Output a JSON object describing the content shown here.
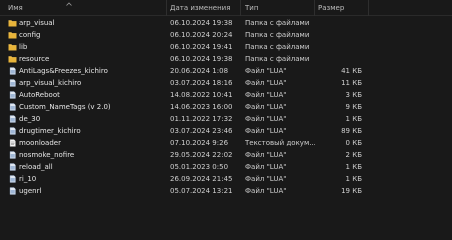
{
  "columns": {
    "name": "Имя",
    "date": "Дата изменения",
    "type": "Тип",
    "size": "Размер"
  },
  "rows": [
    {
      "kind": "folder",
      "name": "arp_visual",
      "date": "06.10.2024 19:38",
      "type": "Папка с файлами",
      "size": ""
    },
    {
      "kind": "folder",
      "name": "config",
      "date": "06.10.2024 20:24",
      "type": "Папка с файлами",
      "size": ""
    },
    {
      "kind": "folder",
      "name": "lib",
      "date": "06.10.2024 19:41",
      "type": "Папка с файлами",
      "size": ""
    },
    {
      "kind": "folder",
      "name": "resource",
      "date": "06.10.2024 19:38",
      "type": "Папка с файлами",
      "size": ""
    },
    {
      "kind": "file",
      "name": "AntiLags&Freezes_kichiro",
      "date": "20.06.2024 1:08",
      "type": "Файл \"LUA\"",
      "size": "41 КБ"
    },
    {
      "kind": "file",
      "name": "arp_visual_kichiro",
      "date": "03.07.2024 18:16",
      "type": "Файл \"LUA\"",
      "size": "11 КБ"
    },
    {
      "kind": "file",
      "name": "AutoReboot",
      "date": "14.08.2022 10:41",
      "type": "Файл \"LUA\"",
      "size": "3 КБ"
    },
    {
      "kind": "file",
      "name": "Custom_NameTags (v 2.0)",
      "date": "14.06.2023 16:00",
      "type": "Файл \"LUA\"",
      "size": "9 КБ"
    },
    {
      "kind": "file",
      "name": "de_30",
      "date": "01.11.2022 17:32",
      "type": "Файл \"LUA\"",
      "size": "1 КБ"
    },
    {
      "kind": "file",
      "name": "drugtimer_kichiro",
      "date": "03.07.2024 23:46",
      "type": "Файл \"LUA\"",
      "size": "89 КБ"
    },
    {
      "kind": "text",
      "name": "moonloader",
      "date": "07.10.2024 9:26",
      "type": "Текстовый докум...",
      "size": "0 КБ"
    },
    {
      "kind": "file",
      "name": "nosmoke_nofire",
      "date": "29.05.2024 22:02",
      "type": "Файл \"LUA\"",
      "size": "2 КБ"
    },
    {
      "kind": "file",
      "name": "reload_all",
      "date": "05.01.2023 0:50",
      "type": "Файл \"LUA\"",
      "size": "1 КБ"
    },
    {
      "kind": "file",
      "name": "ri_10",
      "date": "26.09.2024 21:45",
      "type": "Файл \"LUA\"",
      "size": "1 КБ"
    },
    {
      "kind": "file",
      "name": "ugenrl",
      "date": "05.07.2024 13:21",
      "type": "Файл \"LUA\"",
      "size": "19 КБ"
    }
  ],
  "icons": {
    "folder": "folder-icon",
    "file": "lua-file-icon",
    "text": "text-file-icon"
  },
  "colors": {
    "background": "#191919",
    "folder": "#f2c14e",
    "file": "#9fb7d6"
  }
}
